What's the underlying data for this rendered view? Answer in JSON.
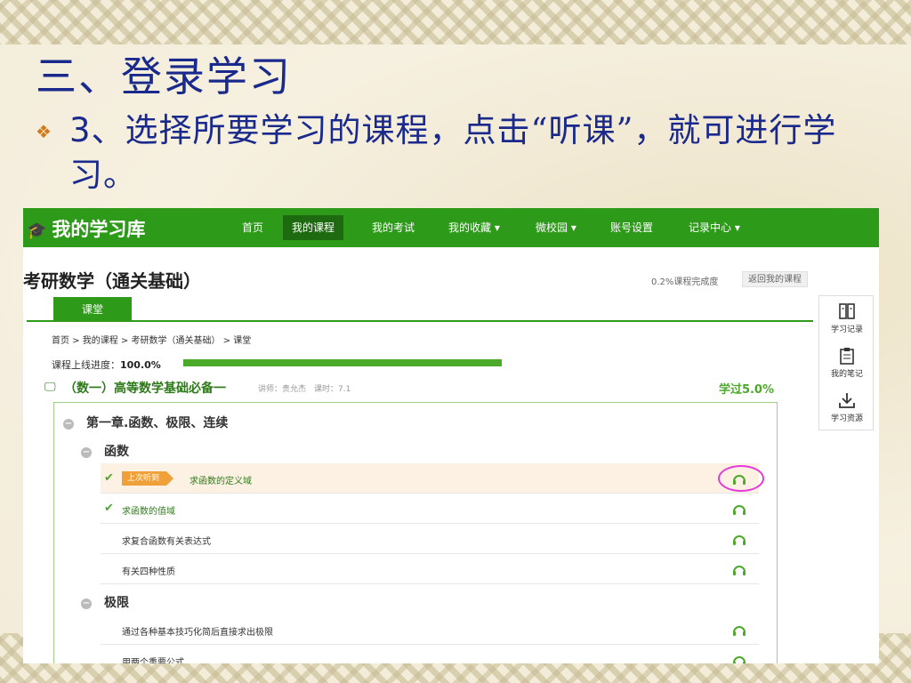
{
  "slide": {
    "title": "三、登录学习",
    "bullet_mark": "❖",
    "bullet_num": "3",
    "bullet_text": "、选择所要学习的课程，点击“听课”，就可进行学习。"
  },
  "navbar": {
    "logo": "我的学习库",
    "items": [
      "首页",
      "我的课程",
      "我的考试",
      "我的收藏 ▾",
      "微校园 ▾",
      "账号设置",
      "记录中心 ▾"
    ],
    "active_index": 1
  },
  "header": {
    "page_title": "考研数学（通关基础）",
    "completion": "0.2%课程完成度",
    "back_button": "返回我的课程"
  },
  "panel": {
    "tab": "课堂",
    "breadcrumb": "首页 > 我的课程 > 考研数学（通关基础） > 课堂",
    "online_label": "课程上线进度：",
    "online_value": "100.0%",
    "online_fraction": 1.0
  },
  "course": {
    "name": "（数一）高等数学基础必备一",
    "teacher": "讲师：贵允杰　课时：7.1",
    "rate": "学过5.0%"
  },
  "chapter": {
    "title": "第一章.函数、极限、连续",
    "sections": [
      {
        "title": "函数",
        "lessons": [
          {
            "text": "求函数的定义域",
            "tag": "上次听到",
            "done": true,
            "current": true
          },
          {
            "text": "求函数的值域",
            "tag": "",
            "done": true,
            "current": false
          },
          {
            "text": "求复合函数有关表达式",
            "tag": "",
            "done": false,
            "current": false
          },
          {
            "text": "有关四种性质",
            "tag": "",
            "done": false,
            "current": false
          }
        ]
      },
      {
        "title": "极限",
        "lessons": [
          {
            "text": "通过各种基本技巧化简后直接求出极限",
            "tag": "",
            "done": false,
            "current": false
          },
          {
            "text": "用两个重要公式",
            "tag": "",
            "done": false,
            "current": false
          }
        ]
      }
    ]
  },
  "sidebar": {
    "items": [
      "学习记录",
      "我的笔记",
      "学习资源"
    ]
  },
  "colors": {
    "brand_green": "#2e9a1a",
    "title_blue": "#1a2a8c",
    "tag_orange": "#f0a038",
    "highlight": "#e53bd8"
  }
}
